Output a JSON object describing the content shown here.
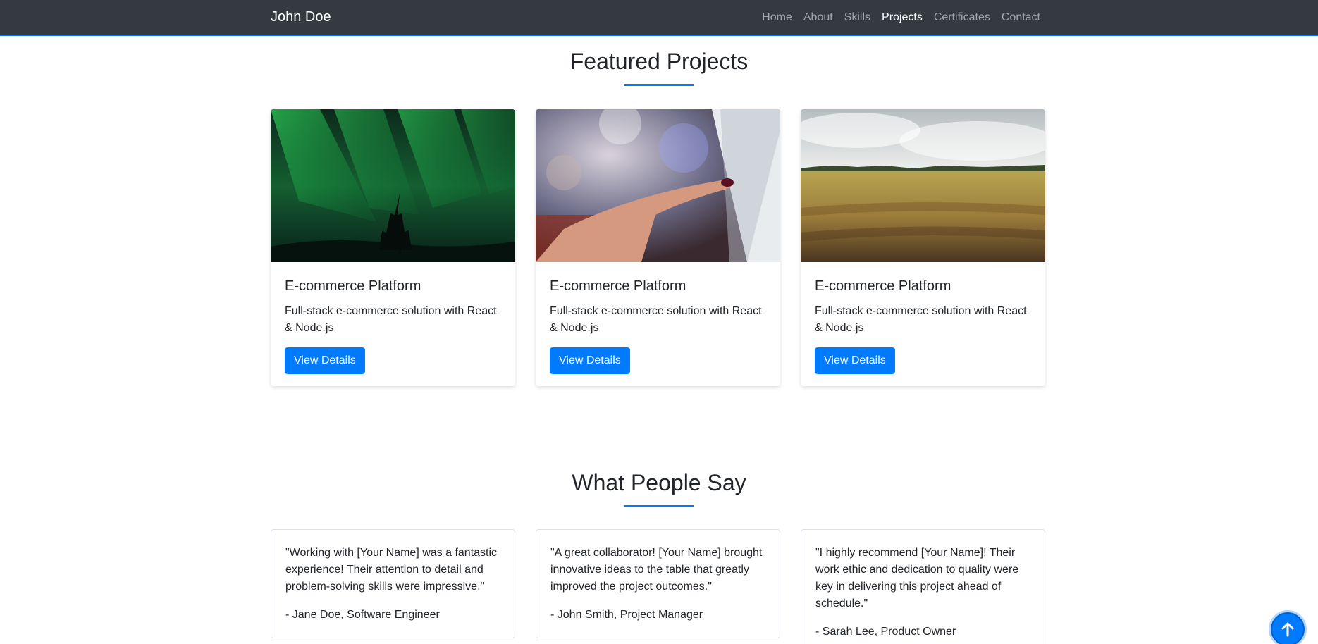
{
  "navbar": {
    "brand": "John Doe",
    "links": [
      {
        "label": "Home"
      },
      {
        "label": "About"
      },
      {
        "label": "Skills"
      },
      {
        "label": "Projects",
        "active": true
      },
      {
        "label": "Certificates"
      },
      {
        "label": "Contact"
      }
    ]
  },
  "projects": {
    "heading": "Featured Projects",
    "cards": [
      {
        "image": "aurora-forest-image",
        "title": "E-commerce Platform",
        "description": "Full-stack e-commerce solution with React & Node.js",
        "button": "View Details"
      },
      {
        "image": "hand-tablet-image",
        "title": "E-commerce Platform",
        "description": "Full-stack e-commerce solution with React & Node.js",
        "button": "View Details"
      },
      {
        "image": "wheat-field-image",
        "title": "E-commerce Platform",
        "description": "Full-stack e-commerce solution with React & Node.js",
        "button": "View Details"
      }
    ]
  },
  "testimonials": {
    "heading": "What People Say",
    "items": [
      {
        "quote": "\"Working with [Your Name] was a fantastic experience! Their attention to detail and problem-solving skills were impressive.\"",
        "author": "- Jane Doe, Software Engineer"
      },
      {
        "quote": "\"A great collaborator! [Your Name] brought innovative ideas to the table that greatly improved the project outcomes.\"",
        "author": "- John Smith, Project Manager"
      },
      {
        "quote": "\"I highly recommend [Your Name]! Their work ethic and dedication to quality were key in delivering this project ahead of schedule.\"",
        "author": "- Sarah Lee, Product Owner"
      }
    ]
  },
  "back_to_top": {
    "icon": "arrow-up-icon"
  },
  "colors": {
    "primary": "#007bff",
    "navbar_bg": "#343a40",
    "text": "#212529"
  }
}
